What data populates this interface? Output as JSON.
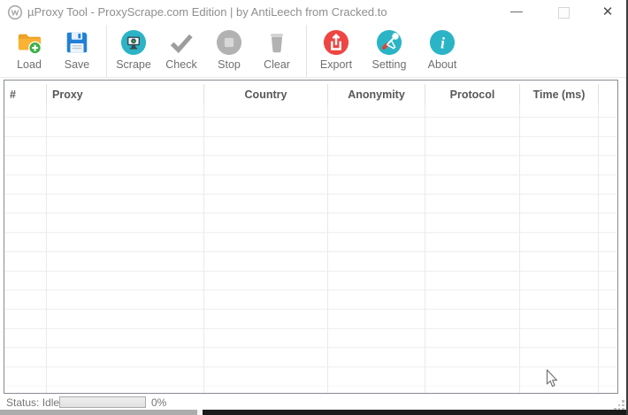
{
  "window": {
    "title": "µProxy Tool - ProxyScrape.com Edition | by AntiLeech from Cracked.to",
    "app_icon": "globe-logo-icon",
    "controls": {
      "minimize": "minimize",
      "maximize": "maximize",
      "close_glyph": "✕"
    }
  },
  "toolbar": {
    "buttons": [
      {
        "label": "Load",
        "icon": "folder-add-icon"
      },
      {
        "label": "Save",
        "icon": "floppy-save-icon"
      },
      {
        "label": "Scrape",
        "icon": "scrape-monitor-icon"
      },
      {
        "label": "Check",
        "icon": "checkmark-icon"
      },
      {
        "label": "Stop",
        "icon": "stop-circle-icon"
      },
      {
        "label": "Clear",
        "icon": "trash-icon"
      },
      {
        "label": "Export",
        "icon": "export-icon"
      },
      {
        "label": "Setting",
        "icon": "tools-icon"
      },
      {
        "label": "About",
        "icon": "info-icon"
      }
    ]
  },
  "table": {
    "columns": [
      {
        "label": "#"
      },
      {
        "label": "Proxy"
      },
      {
        "label": "Country"
      },
      {
        "label": "Anonymity"
      },
      {
        "label": "Protocol"
      },
      {
        "label": "Time (ms)"
      }
    ],
    "rows": []
  },
  "statusbar": {
    "status": "Status: Idle",
    "progress_value": 0,
    "progress_percent_label": "0%"
  },
  "colors": {
    "teal": "#2bb4c6",
    "red": "#ee4643",
    "blue": "#2180d6",
    "orange": "#f9b233",
    "green": "#3fae49",
    "icon_gray": "#aeaeae"
  }
}
